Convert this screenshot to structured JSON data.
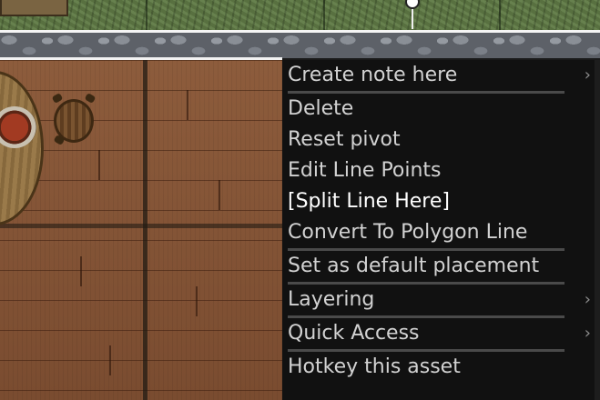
{
  "context_menu": {
    "items": [
      {
        "label": "Create note here",
        "has_submenu": true,
        "submenu_icon": "chevron-right-icon",
        "separator_after": true
      },
      {
        "label": "Delete",
        "has_submenu": false,
        "separator_after": false
      },
      {
        "label": "Reset pivot",
        "has_submenu": false,
        "separator_after": false
      },
      {
        "label": "Edit Line Points",
        "has_submenu": false,
        "separator_after": false
      },
      {
        "label": "[Split Line Here]",
        "has_submenu": false,
        "separator_after": false,
        "highlighted": true
      },
      {
        "label": "Convert To Polygon Line",
        "has_submenu": false,
        "separator_after": true
      },
      {
        "label": "Set as default placement",
        "has_submenu": false,
        "separator_after": true
      },
      {
        "label": "Layering",
        "has_submenu": true,
        "submenu_icon": "chevron-right-icon",
        "separator_after": true
      },
      {
        "label": "Quick Access",
        "has_submenu": true,
        "submenu_icon": "chevron-right-icon",
        "separator_after": true
      },
      {
        "label": "Hotkey this asset",
        "has_submenu": false,
        "separator_after": false
      }
    ],
    "submenu_glyph": "›"
  },
  "map": {
    "scene": [
      "grass-ground",
      "stone-wall",
      "wooden-floor",
      "round-table",
      "bowl",
      "stool",
      "line-pivot-handle"
    ]
  },
  "colors": {
    "menu_background": "#111111",
    "menu_text": "#d2d2d2",
    "menu_highlight_text": "#ffffff",
    "separator": "#4a4a4a"
  }
}
